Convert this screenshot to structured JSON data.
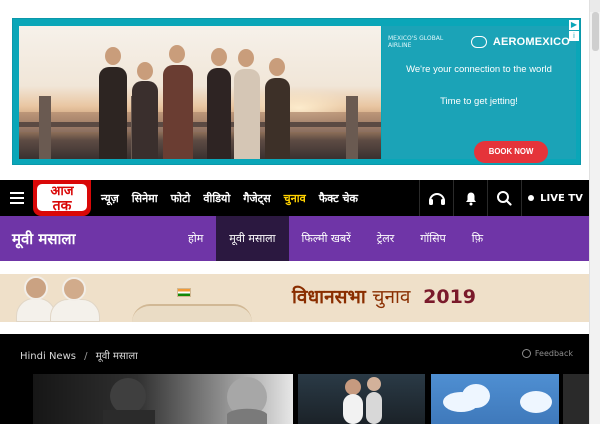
{
  "ad": {
    "brand_tagline": "MEXICO'S GLOBAL AIRLINE",
    "brand_name": "AEROMEXICO",
    "line1": "We're your connection to the world",
    "line2": "Time to get jetting!",
    "cta": "BOOK NOW",
    "badge": "▶",
    "info": "i"
  },
  "topnav": {
    "logo_line1": "आज",
    "logo_line2": "तक",
    "links": [
      "न्यूज़",
      "सिनेमा",
      "फोटो",
      "वीडियो",
      "गैजेट्स",
      "चुनाव",
      "फैक्ट चेक"
    ],
    "live_label": "LIVE TV"
  },
  "section": {
    "title": "मूवी मसाला",
    "tabs": [
      "होम",
      "मूवी मसाला",
      "फिल्मी खबरें",
      "ट्रेलर",
      "गॉसिप",
      "फ़ि"
    ]
  },
  "banner": {
    "title": "विधानसभा",
    "subtitle": "चुनाव",
    "year": "2019"
  },
  "content": {
    "breadcrumb_home": "Hindi News",
    "breadcrumb_sep": "/",
    "breadcrumb_current": "मूवी मसाला",
    "feedback": "Feedback"
  },
  "colors": {
    "ad_bg": "#0aa6b8",
    "cta": "#e5343a",
    "nav_bg": "#000000",
    "logo_red": "#d90808",
    "section_purple": "#6f35a7",
    "active_tab": "#2b1840",
    "election_highlight": "#ffd200"
  }
}
